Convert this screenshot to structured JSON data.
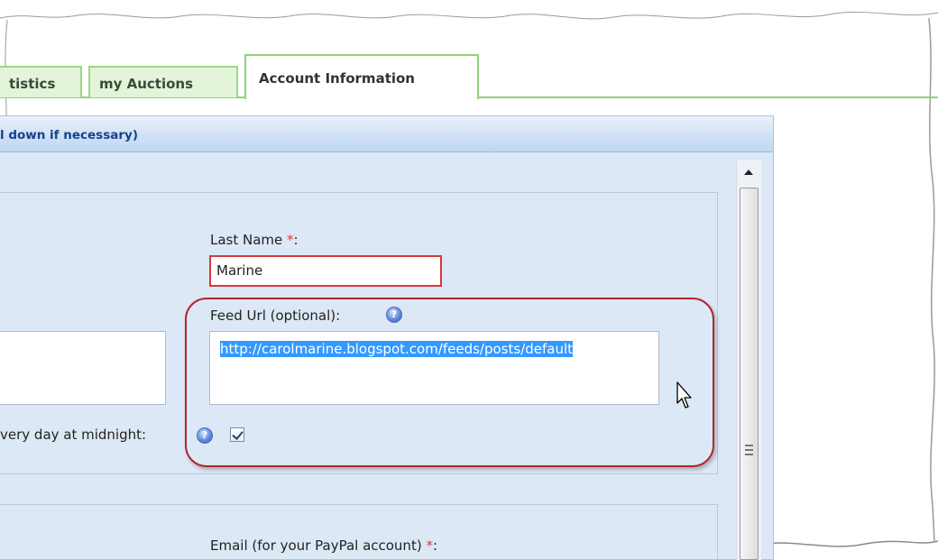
{
  "tabs": [
    {
      "label": "tistics",
      "active": false
    },
    {
      "label": "my Auctions",
      "active": false
    },
    {
      "label": "Account Information",
      "active": true
    }
  ],
  "panel": {
    "header_title": "l down if necessary)"
  },
  "form": {
    "last_name": {
      "label": "Last Name ",
      "required_mark": "*",
      "suffix": ":",
      "value": "Marine"
    },
    "feed_url": {
      "label": "Feed Url (optional):",
      "value": "http://carolmarine.blogspot.com/feeds/posts/default",
      "selected": true
    },
    "update_checkbox": {
      "label": "very day at midnight:",
      "checked": true
    },
    "email": {
      "label": "Email (for your PayPal account) ",
      "required_mark": "*",
      "suffix": ":"
    }
  },
  "colors": {
    "tab_green": "#8fd37a",
    "panel_blue": "#dde8f6",
    "header_text": "#15428b",
    "invalid_red": "#d9383a",
    "annotation_red": "#b3262c",
    "selection_blue": "#3399ff"
  },
  "icons": {
    "help": "help-icon",
    "check": "check-icon",
    "cursor": "mouse-pointer-icon",
    "scroll_up": "arrow-up-icon",
    "scroll_grip": "grip-icon"
  }
}
